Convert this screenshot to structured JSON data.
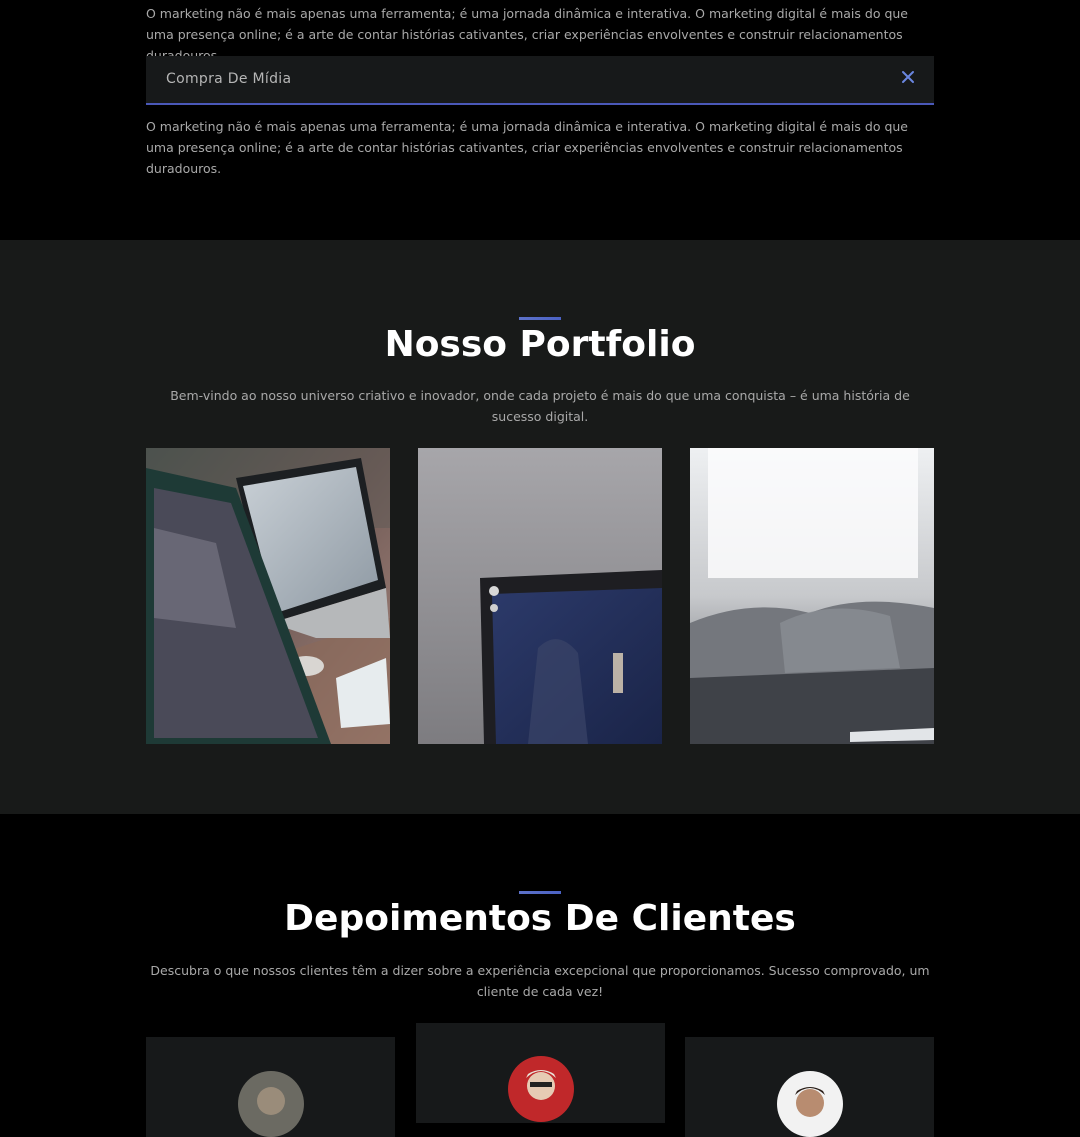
{
  "faq": {
    "paragraph_1": "O marketing não é mais apenas uma ferramenta; é uma jornada dinâmica e interativa. O marketing digital é mais do que uma presença online; é a arte de contar histórias cativantes, criar experiências envolventes e construir relacionamentos duradouros.",
    "item_title": "Compra De Mídia",
    "paragraph_2": "O marketing não é mais apenas uma ferramenta; é uma jornada dinâmica e interativa. O marketing digital é mais do que uma presença online; é a arte de contar histórias cativantes, criar experiências envolventes e construir relacionamentos duradouros.",
    "close_icon": "close-icon"
  },
  "portfolio": {
    "title": "Nosso Portfolio",
    "subtitle": "Bem-vindo ao nosso universo criativo e inovador, onde cada projeto é mais do que uma conquista – é uma história de sucesso digital.",
    "images": [
      "laptops-on-desk-photo",
      "monitor-in-dark-photo",
      "blurred-sofa-photo"
    ]
  },
  "testimonials": {
    "title": "Depoimentos De Clientes",
    "subtitle": "Descubra o que nossos clientes têm a dizer sobre a experiência excepcional que proporcionamos. Sucesso comprovado, um cliente de cada vez!"
  },
  "colors": {
    "accent": "#4b62c4",
    "section_dark": "#181a19",
    "background": "#000000"
  }
}
